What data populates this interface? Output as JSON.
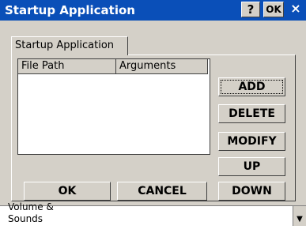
{
  "window": {
    "title": "Startup Application",
    "help_label": "?",
    "ok_label": "OK",
    "close_label": "×"
  },
  "tab": {
    "label": "Startup Application"
  },
  "list": {
    "columns": [
      "File Path",
      "Arguments"
    ]
  },
  "side_buttons": {
    "add": "ADD",
    "delete": "DELETE",
    "modify": "MODIFY",
    "up": "UP",
    "down": "DOWN"
  },
  "footer_buttons": {
    "ok": "OK",
    "cancel": "CANCEL"
  },
  "background_list": {
    "item_partial": "Volume &",
    "item_label": "Sounds"
  }
}
